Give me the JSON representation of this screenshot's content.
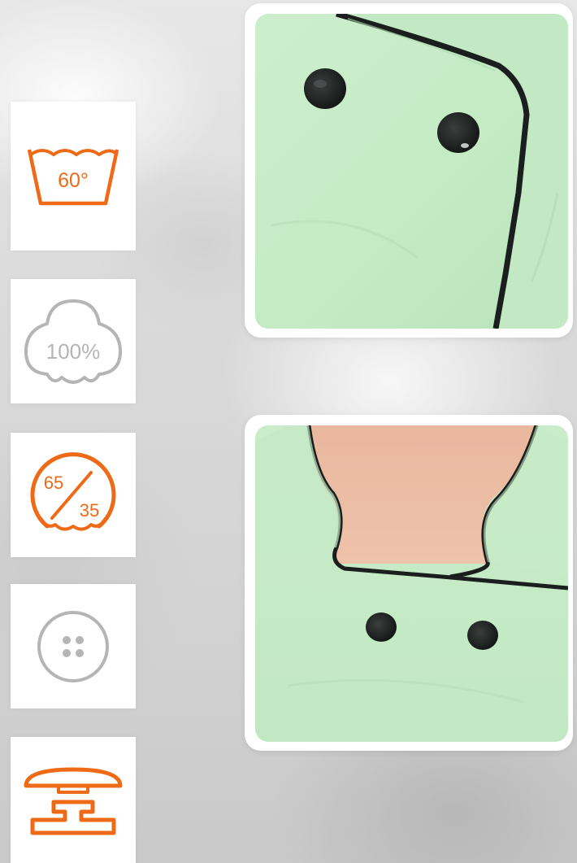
{
  "colors": {
    "accent": "#ee6a16",
    "neutral_icon": "#b5b5b5",
    "fabric": "#c5ecc6",
    "piping": "#1a1f1d",
    "button": "#1d2121",
    "skin": "#ebb9a0"
  },
  "icons": [
    {
      "name": "wash-60-icon",
      "label": "60°"
    },
    {
      "name": "cotton-100-icon",
      "label": "100%"
    },
    {
      "name": "blend-65-35-icon",
      "top_label": "65",
      "bottom_label": "35"
    },
    {
      "name": "button-icon"
    },
    {
      "name": "snap-fastener-icon"
    }
  ],
  "photos": [
    {
      "name": "jacket-front-buttons-photo"
    },
    {
      "name": "jacket-collar-photo"
    }
  ]
}
